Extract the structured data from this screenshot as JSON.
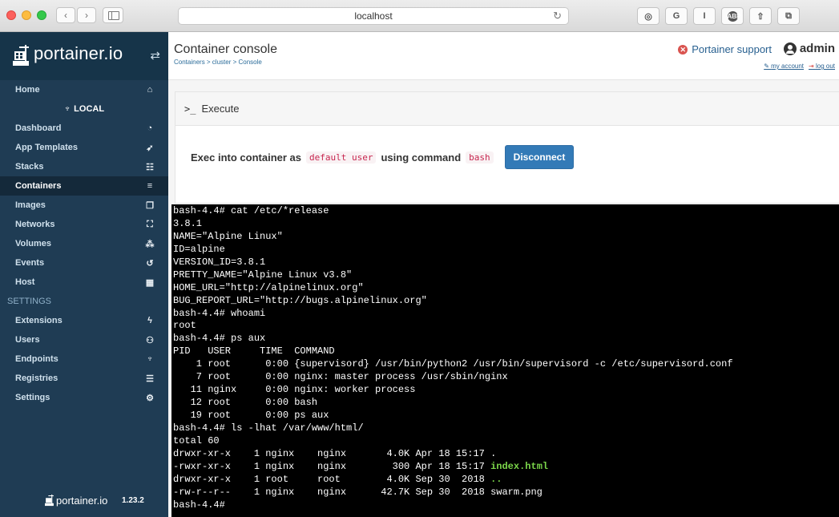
{
  "browser": {
    "url": "localhost",
    "reload_glyph": "↻",
    "nav_back": "‹",
    "nav_forward": "›",
    "extensions": [
      {
        "name": "reader-icon",
        "glyph": "◎"
      },
      {
        "name": "grammarly-icon",
        "glyph": "G"
      },
      {
        "name": "text-cursor-icon",
        "glyph": "I"
      },
      {
        "name": "adblock-icon",
        "glyph": "ABP"
      },
      {
        "name": "share-icon",
        "glyph": "⇧"
      },
      {
        "name": "tabs-icon",
        "glyph": "⧉"
      }
    ]
  },
  "sidebar": {
    "brand": "portainer.io",
    "toggle_glyph": "⇄",
    "home": {
      "label": "Home",
      "icon": "home-icon",
      "glyph": "⌂"
    },
    "environment": "LOCAL",
    "items": [
      {
        "label": "Dashboard",
        "icon": "dashboard-icon",
        "glyph": "◔"
      },
      {
        "label": "App Templates",
        "icon": "rocket-icon",
        "glyph": "➶"
      },
      {
        "label": "Stacks",
        "icon": "th-list-icon",
        "glyph": "☷"
      },
      {
        "label": "Containers",
        "icon": "server-icon",
        "glyph": "≡",
        "active": true
      },
      {
        "label": "Images",
        "icon": "clone-icon",
        "glyph": "❐"
      },
      {
        "label": "Networks",
        "icon": "sitemap-icon",
        "glyph": "⛶"
      },
      {
        "label": "Volumes",
        "icon": "cubes-icon",
        "glyph": "⁂"
      },
      {
        "label": "Events",
        "icon": "history-icon",
        "glyph": "↺"
      },
      {
        "label": "Host",
        "icon": "th-icon",
        "glyph": "▦"
      }
    ],
    "settings_label": "SETTINGS",
    "settings_items": [
      {
        "label": "Extensions",
        "icon": "bolt-icon",
        "glyph": "ϟ"
      },
      {
        "label": "Users",
        "icon": "users-icon",
        "glyph": "⚇"
      },
      {
        "label": "Endpoints",
        "icon": "plug-icon",
        "glyph": "♆"
      },
      {
        "label": "Registries",
        "icon": "database-icon",
        "glyph": "☰"
      },
      {
        "label": "Settings",
        "icon": "cogs-icon",
        "glyph": "⚙"
      }
    ],
    "footer_brand": "portainer.io",
    "version": "1.23.2"
  },
  "header": {
    "title": "Container console",
    "breadcrumb": "Containers > cluster > Console",
    "support": "Portainer support",
    "user": "admin",
    "my_account": "my account",
    "log_out": "log out"
  },
  "execute": {
    "title": "Execute",
    "prefix": "Exec into container as",
    "user": "default user",
    "middle": "using command",
    "command": "bash",
    "button": "Disconnect"
  },
  "terminal": {
    "lines": [
      "bash-4.4# cat /etc/*release",
      "3.8.1",
      "NAME=\"Alpine Linux\"",
      "ID=alpine",
      "VERSION_ID=3.8.1",
      "PRETTY_NAME=\"Alpine Linux v3.8\"",
      "HOME_URL=\"http://alpinelinux.org\"",
      "BUG_REPORT_URL=\"http://bugs.alpinelinux.org\"",
      "bash-4.4# whoami",
      "root",
      "bash-4.4# ps aux",
      "PID   USER     TIME  COMMAND",
      "    1 root      0:00 {supervisord} /usr/bin/python2 /usr/bin/supervisord -c /etc/supervisord.conf",
      "    7 root      0:00 nginx: master process /usr/sbin/nginx",
      "   11 nginx     0:00 nginx: worker process",
      "   12 root      0:00 bash",
      "   19 root      0:00 ps aux",
      "bash-4.4# ls -lhat /var/www/html/",
      "total 60",
      "drwxr-xr-x    1 nginx    nginx       4.0K Apr 18 15:17 .",
      "-rwxr-xr-x    1 nginx    nginx        300 Apr 18 15:17 |index.html",
      "drwxr-xr-x    1 root     root        4.0K Sep 30  2018 |..",
      "-rw-r--r--    1 nginx    nginx      42.7K Sep 30  2018 swarm.png",
      "bash-4.4# "
    ]
  }
}
